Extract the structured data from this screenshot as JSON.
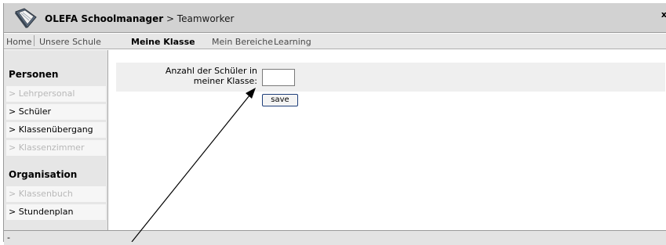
{
  "window": {
    "brand": "OLEFA Schoolmanager",
    "breadcrumb": " > Teamworker",
    "close_glyph": "x"
  },
  "nav": {
    "items": [
      {
        "label": "Home"
      },
      {
        "label": "Unsere Schule"
      },
      {
        "label": "Meine Klasse",
        "active": true
      },
      {
        "label": "Mein Bereiche"
      },
      {
        "label": "Learning"
      }
    ]
  },
  "sidebar": {
    "sections": [
      {
        "heading": "Personen",
        "items": [
          {
            "label": "> Lehrpersonal",
            "enabled": false
          },
          {
            "label": "> Schüler",
            "enabled": true
          },
          {
            "label": "> Klassenübergang",
            "enabled": true
          },
          {
            "label": "> Klassenzimmer",
            "enabled": false
          }
        ]
      },
      {
        "heading": "Organisation",
        "items": [
          {
            "label": "> Klassenbuch",
            "enabled": false
          },
          {
            "label": "> Stundenplan",
            "enabled": true
          }
        ]
      }
    ]
  },
  "form": {
    "label_line1": "Anzahl der Schüler in",
    "label_line2": "meiner Klasse:",
    "value": "",
    "save_label": "save"
  },
  "footer": {
    "text": "-"
  },
  "icons": {
    "logo": "book-logo-icon"
  },
  "colors": {
    "titlebar": "#d2d2d2",
    "navbar": "#e7e7e7",
    "sidebar": "#e6e6e6",
    "disabled_text": "#b8b8b8",
    "button_border": "#1f3f7a"
  }
}
